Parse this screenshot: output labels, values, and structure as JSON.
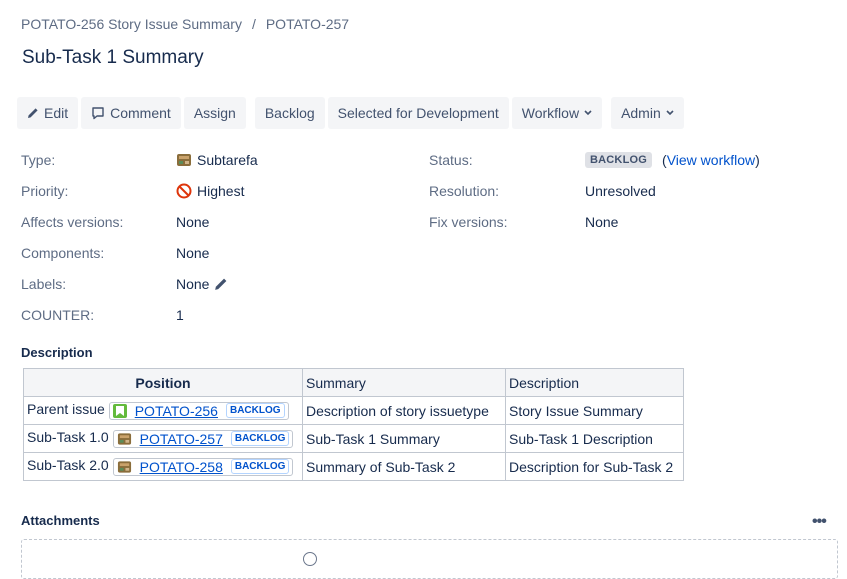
{
  "breadcrumb": {
    "parent": "POTATO-256 Story Issue Summary",
    "separator": "/",
    "current": "POTATO-257"
  },
  "title": "Sub-Task 1 Summary",
  "toolbar": {
    "edit": "Edit",
    "comment": "Comment",
    "assign": "Assign",
    "backlog": "Backlog",
    "selected": "Selected for Development",
    "workflow": "Workflow",
    "admin": "Admin"
  },
  "fields_left": {
    "type_label": "Type:",
    "type_value": "Subtarefa",
    "priority_label": "Priority:",
    "priority_value": "Highest",
    "affects_label": "Affects versions:",
    "affects_value": "None",
    "components_label": "Components:",
    "components_value": "None",
    "labels_label": "Labels:",
    "labels_value": "None",
    "counter_label": "COUNTER:",
    "counter_value": "1"
  },
  "fields_right": {
    "status_label": "Status:",
    "status_value": "BACKLOG",
    "view_workflow_open": "(",
    "view_workflow": "View workflow",
    "view_workflow_close": ")",
    "resolution_label": "Resolution:",
    "resolution_value": "Unresolved",
    "fix_label": "Fix versions:",
    "fix_value": "None"
  },
  "description": {
    "heading": "Description",
    "headers": [
      "Position",
      "Summary",
      "Description"
    ],
    "rows": [
      {
        "position": "Parent issue",
        "key": "POTATO-256",
        "status": "BACKLOG",
        "icon": "story-icon",
        "summary": "Description of story issuetype",
        "description": "Story Issue Summary"
      },
      {
        "position": "Sub-Task 1.0",
        "key": "POTATO-257",
        "status": "BACKLOG",
        "icon": "subtask-icon",
        "summary": "Sub-Task 1 Summary",
        "description": "Sub-Task 1 Description"
      },
      {
        "position": "Sub-Task 2.0",
        "key": "POTATO-258",
        "status": "BACKLOG",
        "icon": "subtask-icon",
        "summary": "Summary of Sub-Task 2",
        "description": "Description for Sub-Task 2"
      }
    ]
  },
  "attachments": {
    "heading": "Attachments",
    "more": "•••"
  },
  "colors": {
    "link": "#0052cc",
    "text": "#172b4d",
    "muted": "#5e6c84",
    "button_bg": "#f4f5f7",
    "priority": "#de350b",
    "story": "#63ba3c"
  }
}
